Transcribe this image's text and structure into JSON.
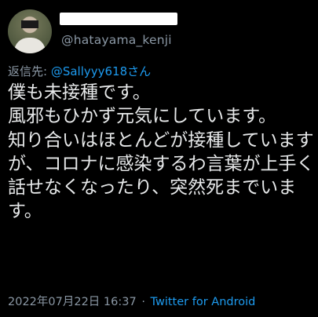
{
  "tweet": {
    "author": {
      "username": "@hatayama_kenji"
    },
    "reply_prefix": "返信先: ",
    "reply_to": "@Sallyyy618さん",
    "text": "僕も未接種です。\n風邪もひかず元気にしています。\n知り合いはほとんどが接種していますが、コロナに感染するわ言葉が上手く話せなくなったり、突然死までいます。",
    "timestamp": "2022年07月22日 16:37",
    "separator": "·",
    "source": "Twitter for Android"
  },
  "colors": {
    "background": "#000000",
    "text": "#e7e9ea",
    "muted": "#8b98a5",
    "accent": "#1d9bf0"
  }
}
